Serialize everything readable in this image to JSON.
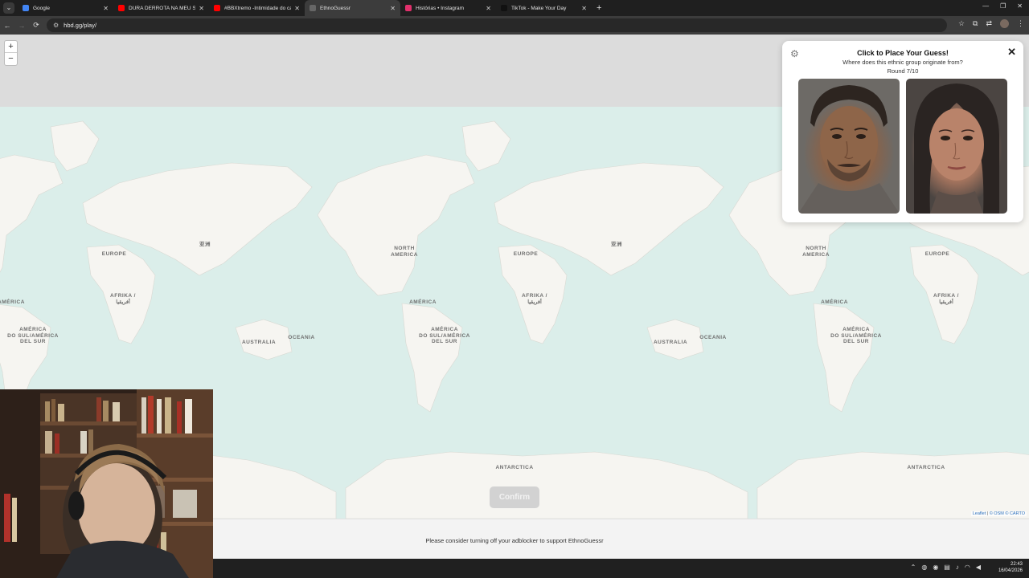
{
  "browser": {
    "tabs": [
      {
        "title": "Google",
        "favicon_color": "#4285f4",
        "active": false
      },
      {
        "title": "DURA DERROTA NA MEU SEGU",
        "favicon_color": "#ff0000",
        "active": false
      },
      {
        "title": "#BBXtremo -Intimidade do ca",
        "favicon_color": "#ff0000",
        "active": false
      },
      {
        "title": "EthnoGuessr",
        "favicon_color": "#666666",
        "active": true
      },
      {
        "title": "Histórias • Instagram",
        "favicon_color": "#e1306c",
        "active": false
      },
      {
        "title": "TikTok - Make Your Day",
        "favicon_color": "#111111",
        "active": false
      }
    ],
    "url": "hbd.gg/play/"
  },
  "map": {
    "zoom_in": "+",
    "zoom_out": "−",
    "labels": [
      {
        "text": "NORTH\nAMERICA"
      },
      {
        "text": "EUROPE"
      },
      {
        "text": "AFRIKA /\nأفريقيا"
      },
      {
        "text": "AMÉRICA"
      },
      {
        "text": "AMÉRICA\nDO SUL/AMÉRICA\nDEL SUR"
      },
      {
        "text": "AUSTRALIA"
      },
      {
        "text": "OCEANIA"
      },
      {
        "text": "ANTARCTICA"
      },
      {
        "text": "亚洲"
      }
    ]
  },
  "panel": {
    "title": "Click to Place Your Guess!",
    "question": "Where does this ethnic group originate from?",
    "round": "Round 7/10",
    "close_label": "✕",
    "settings_icon": "gear-icon"
  },
  "confirm_label": "Confirm",
  "attribution": {
    "leaflet": "Leaflet",
    "osm": "© OSM",
    "carto": "© CARTO"
  },
  "footer_message": "Please consider turning off your adblocker to support EthnoGuessr",
  "taskbar": {
    "time": "22:43",
    "date": "16/04/2026"
  },
  "colors": {
    "ocean": "#dbeeea",
    "land": "#f6f5f1",
    "panel_bg": "#ffffff",
    "confirm_disabled": "#d2d2d2"
  }
}
